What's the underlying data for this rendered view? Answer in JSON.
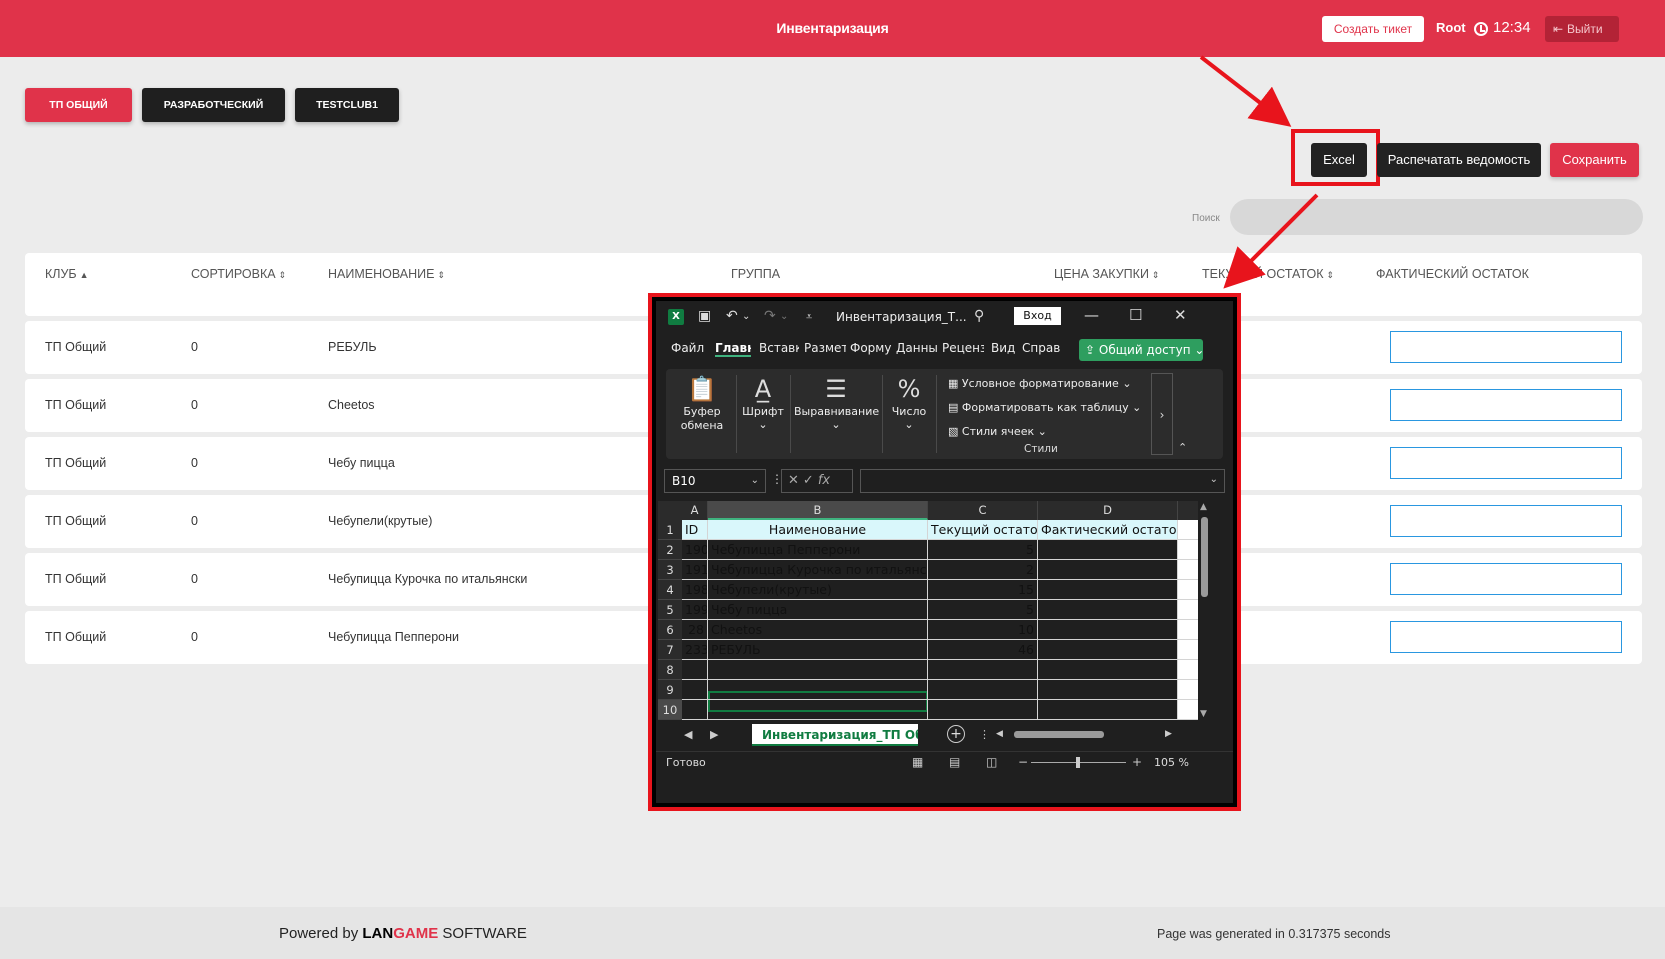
{
  "header": {
    "title": "Инвентаризация",
    "create_ticket": "Создать тикет",
    "user": "Root",
    "time": "12:34",
    "logout": "Выйти",
    "brand_color": "#e0334a"
  },
  "club_tabs": [
    "ТП ОБЩИЙ",
    "РАЗРАБОТЧЕСКИЙ",
    "TESTCLUB1"
  ],
  "actions": {
    "excel": "Excel",
    "print": "Распечатать ведомость",
    "save": "Сохранить"
  },
  "search": {
    "label": "Поиск",
    "value": ""
  },
  "table": {
    "columns": [
      "КЛУБ",
      "СОРТИРОВКА",
      "НАИМЕНОВАНИЕ",
      "ГРУППА",
      "ЦЕНА ЗАКУПКИ",
      "ТЕКУЩИЙ ОСТАТОК",
      "ФАКТИЧЕСКИЙ ОСТАТОК"
    ],
    "rows": [
      {
        "club": "ТП Общий",
        "sort": "0",
        "name": "РЕБУЛЬ"
      },
      {
        "club": "ТП Общий",
        "sort": "0",
        "name": "Cheetos"
      },
      {
        "club": "ТП Общий",
        "sort": "0",
        "name": "Чебу пицца"
      },
      {
        "club": "ТП Общий",
        "sort": "0",
        "name": "Чебупели(крутые)"
      },
      {
        "club": "ТП Общий",
        "sort": "0",
        "name": "Чебупицца Курочка по итальянски"
      },
      {
        "club": "ТП Общий",
        "sort": "0",
        "name": "Чебупицца Пепперони"
      }
    ]
  },
  "footer": {
    "powered_prefix": "Powered by",
    "brand_part1": "LAN",
    "brand_part2": "GAME",
    "brand_suffix": "SOFTWARE",
    "generated": "Page was generated in 0.317375 seconds"
  },
  "excel_window": {
    "filename": "Инвентаризация_Т...",
    "login": "Вход",
    "ribbon_tabs": [
      "Файл",
      "Главн",
      "Вставк",
      "Размет",
      "Форму",
      "Данны",
      "Реценз",
      "Вид",
      "Справ"
    ],
    "share": "Общий доступ",
    "ribbon": {
      "clipboard": "Буфер обмена",
      "font": "Шрифт",
      "alignment": "Выравнивание",
      "number": "Число",
      "conditional": "Условное форматирование",
      "format_table": "Форматировать как таблицу",
      "cell_styles": "Стили ячеек",
      "styles_group": "Стили"
    },
    "name_box": "B10",
    "fx": "fx",
    "columns": [
      "A",
      "B",
      "C",
      "D"
    ],
    "rows": [
      [
        "ID",
        "Наименование",
        "Текущий остаток",
        "Фактический остаток"
      ],
      [
        "190",
        "Чебупицца Пепперони",
        "5",
        ""
      ],
      [
        "191",
        "Чебупицца Курочка по итальянски",
        "2",
        ""
      ],
      [
        "198",
        "Чебупели(крутые)",
        "15",
        ""
      ],
      [
        "199",
        "Чебу пицца",
        "5",
        ""
      ],
      [
        "28",
        "Cheetos",
        "10",
        ""
      ],
      [
        "233",
        "РЕБУЛЬ",
        "46",
        ""
      ],
      [
        "",
        "",
        "",
        ""
      ],
      [
        "",
        "",
        "",
        ""
      ],
      [
        "",
        "",
        "",
        ""
      ]
    ],
    "row_numbers": [
      "1",
      "2",
      "3",
      "4",
      "5",
      "6",
      "7",
      "8",
      "9",
      "10"
    ],
    "sheet_tab": "Инвентаризация_ТП Общий",
    "status": "Готово",
    "zoom": "105 %"
  }
}
